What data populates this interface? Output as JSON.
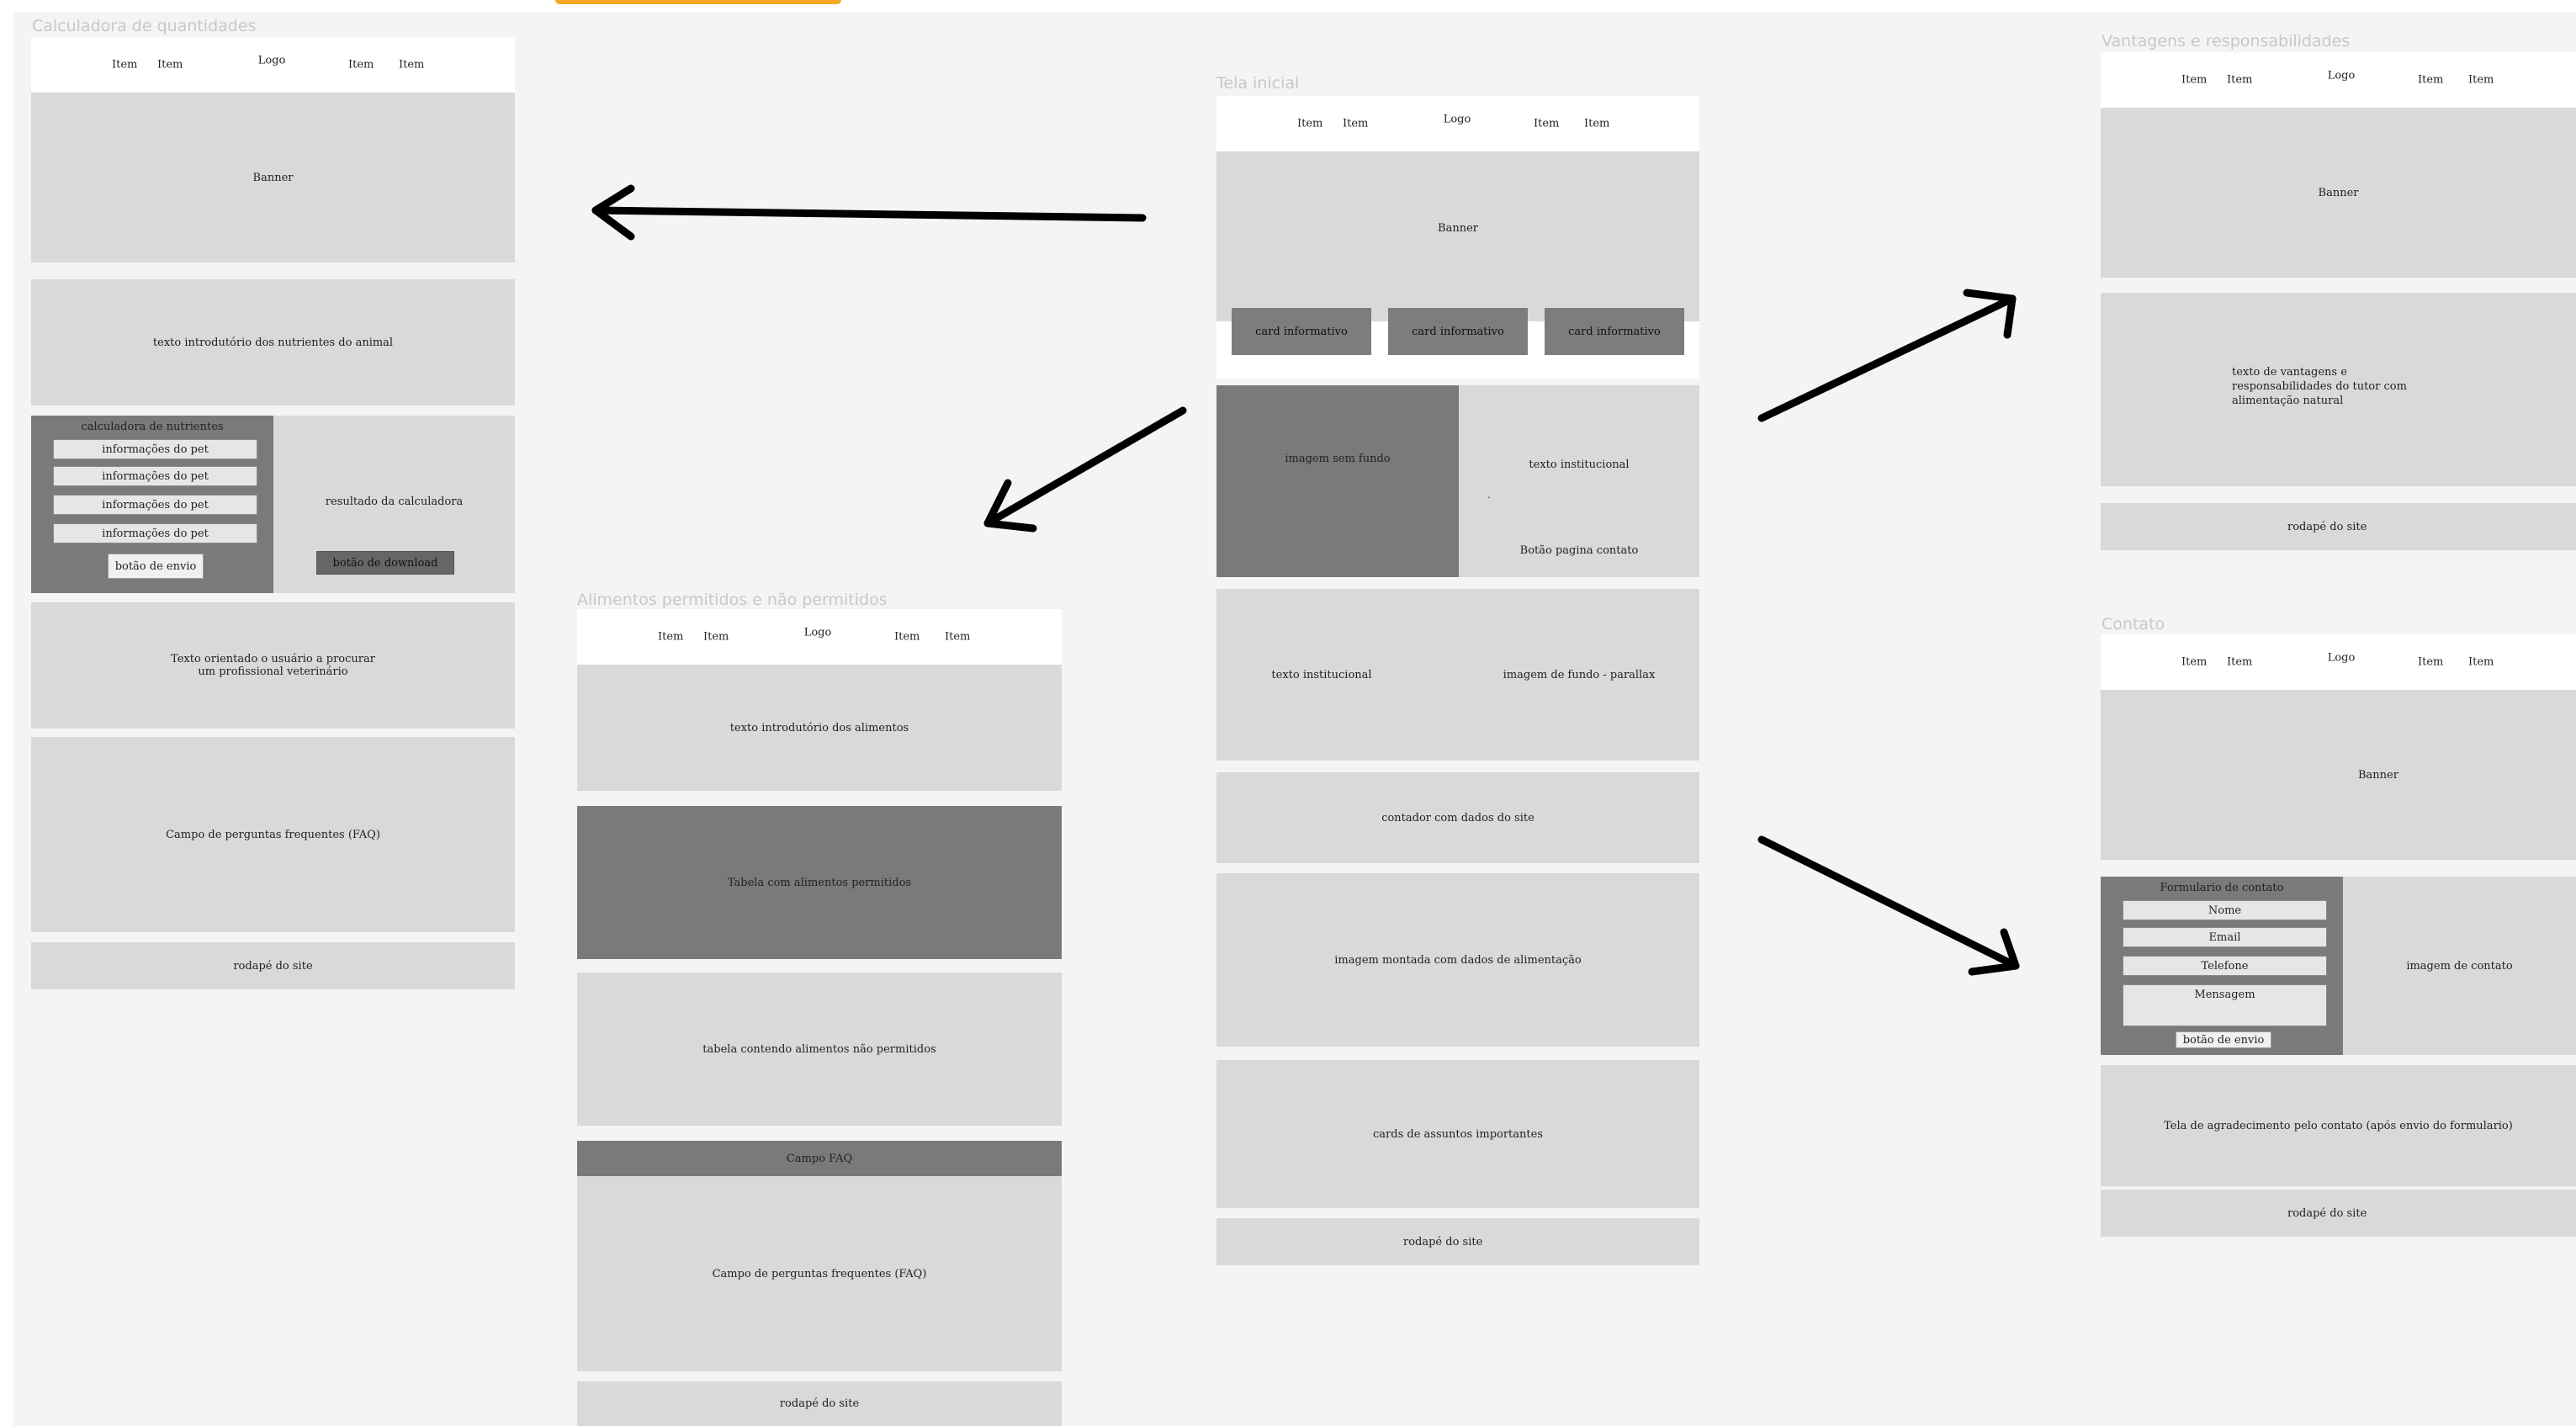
{
  "nav": {
    "item": "Item",
    "logo": "Logo"
  },
  "common": {
    "banner": "Banner",
    "footer": "rodapé do site",
    "send_button": "botão de envio"
  },
  "calc": {
    "title": "Calculadora de quantidades",
    "intro": "texto introdutório dos nutrientes do animal",
    "calculator_title": "calculadora de nutrientes",
    "pet_info": "informações do pet",
    "result": "resultado da calculadora",
    "download_button": "botão de download",
    "vet_text_1": "Texto orientado o usuário a procurar",
    "vet_text_2": "um profissional veterinário",
    "faq": "Campo de perguntas frequentes (FAQ)"
  },
  "alimentos": {
    "title": "Alimentos permitidos e não permitidos",
    "intro": "texto introdutório dos alimentos",
    "allowed_table": "Tabela com alimentos permitidos",
    "forbidden_table": "tabela contendo alimentos não permitidos",
    "faq_header": "Campo FAQ",
    "faq": "Campo de perguntas frequentes (FAQ)"
  },
  "home": {
    "title": "Tela inicial",
    "card": "card informativo",
    "image_no_bg": "imagem sem fundo",
    "institutional_text": "texto institucional",
    "dot": ".",
    "contact_page_button": "Botão pagina contato",
    "parallax_image": "imagem de fundo - parallax",
    "counter": "contador com dados do site",
    "feeding_image": "imagem montada com  dados de alimentação",
    "topic_cards": "cards de assuntos importantes"
  },
  "vantagens": {
    "title": "Vantagens e responsabilidades",
    "text_1": "texto de vantagens e",
    "text_2": "responsabilidades do tutor com",
    "text_3": "alimentação natural"
  },
  "contato": {
    "title": "Contato",
    "form_title": "Formulario de contato",
    "name": "Nome",
    "email": "Email",
    "phone": "Telefone",
    "message": "Mensagem",
    "contact_image": "imagem de contato",
    "thanks": "Tela de agradecimento pelo contato (após envio do formulario)"
  }
}
